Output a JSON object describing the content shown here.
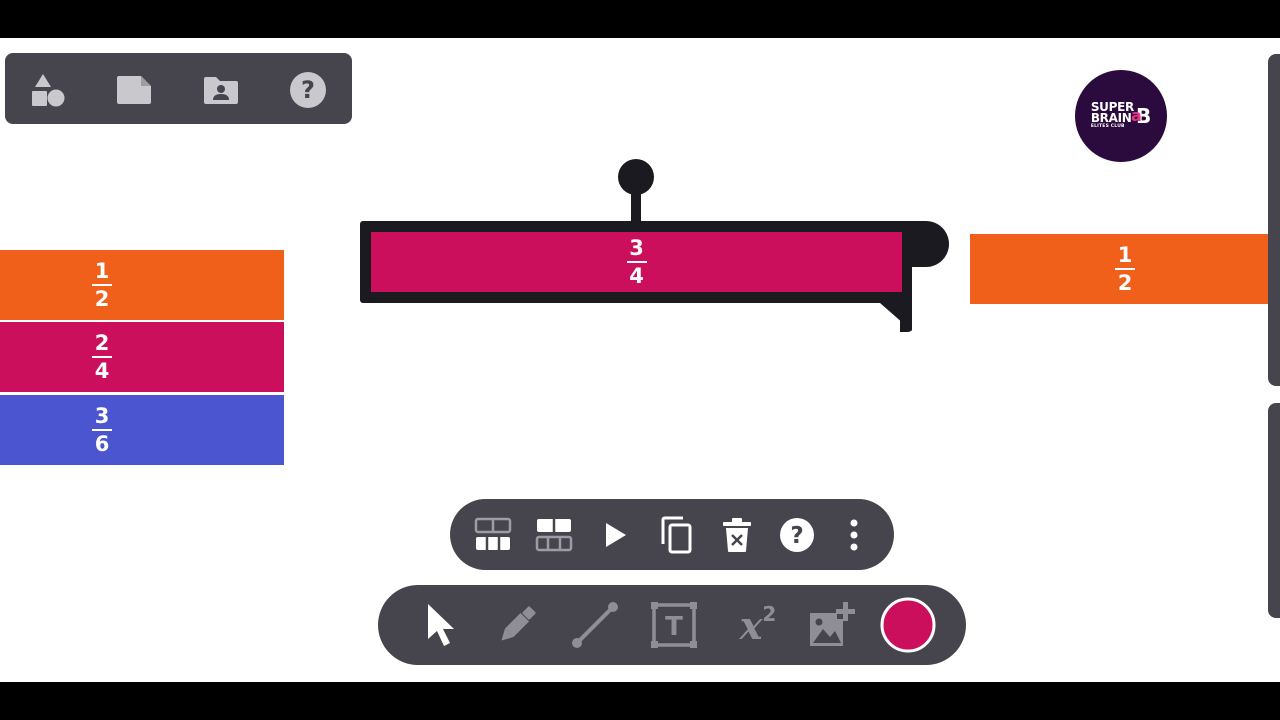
{
  "top_toolbar": {
    "icons": [
      "shapes-icon",
      "note-icon",
      "folder-user-icon",
      "help-icon"
    ]
  },
  "left_strips": [
    {
      "num": "1",
      "den": "2",
      "color": "#f0601a"
    },
    {
      "num": "2",
      "den": "4",
      "color": "#cc0f5d"
    },
    {
      "num": "3",
      "den": "6",
      "color": "#4b55cf"
    }
  ],
  "selected_strip": {
    "num": "3",
    "den": "4",
    "color": "#cc0f5d"
  },
  "right_strip": {
    "num": "1",
    "den": "2",
    "color": "#f0601a"
  },
  "logo": {
    "line1": "SUPER",
    "line2": "BRAIN",
    "line3": "ELITES CLUB",
    "mark": "B"
  },
  "context_toolbar": {
    "icons": [
      "split-more-icon",
      "split-less-icon",
      "play-icon",
      "duplicate-icon",
      "delete-icon",
      "help-icon",
      "more-icon"
    ]
  },
  "main_toolbar": {
    "tools": [
      "select-tool-icon",
      "pen-tool-icon",
      "line-tool-icon",
      "text-tool-icon",
      "equation-tool-icon",
      "add-image-icon",
      "color-picker"
    ],
    "equation_label": "x",
    "equation_power": "2",
    "text_tool_letter": "T",
    "current_color": "#cc0f5d"
  }
}
